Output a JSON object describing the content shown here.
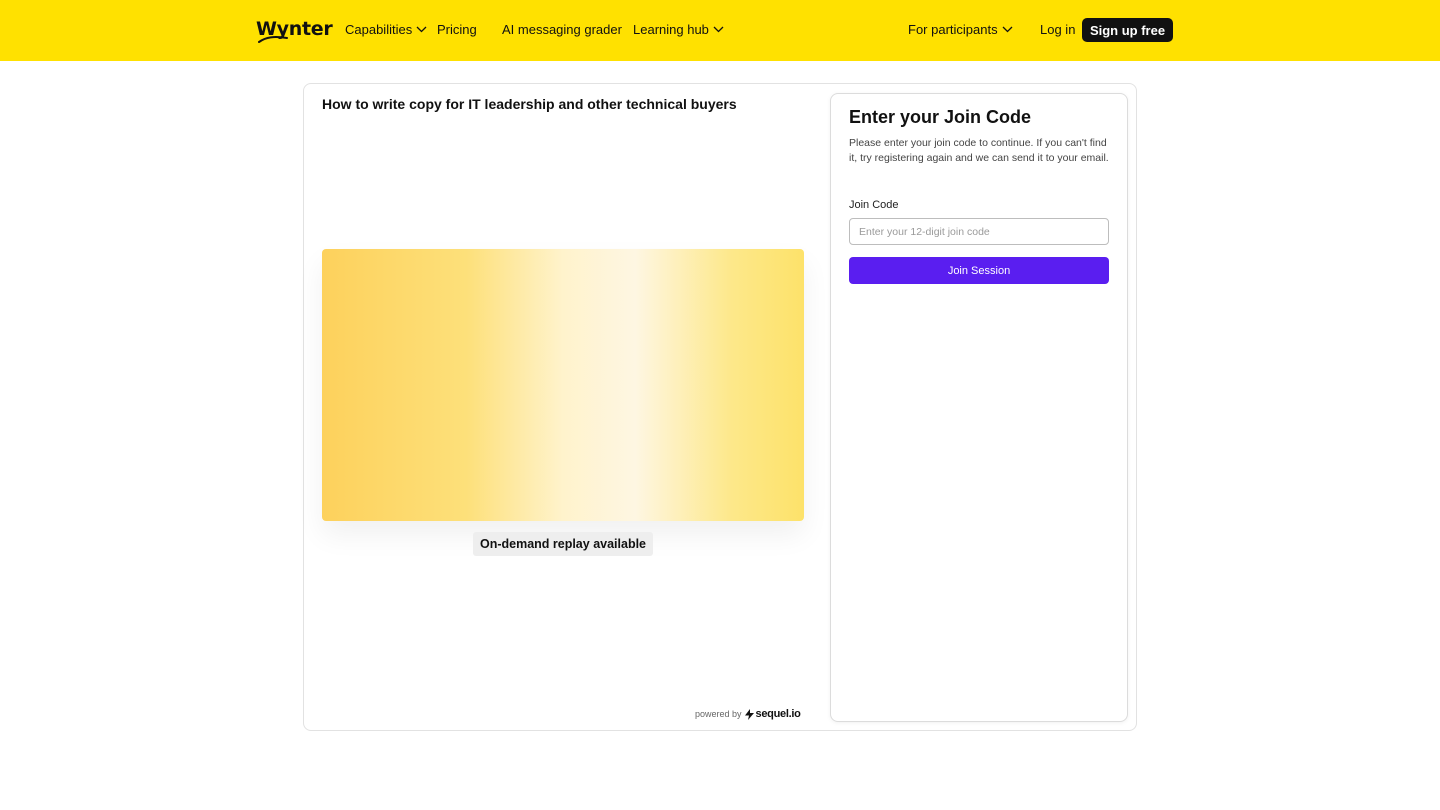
{
  "nav": {
    "logo": "Wynter",
    "items": [
      {
        "label": "Capabilities",
        "has_dropdown": true
      },
      {
        "label": "Pricing",
        "has_dropdown": false
      },
      {
        "label": "AI messaging grader",
        "has_dropdown": false
      },
      {
        "label": "Learning hub",
        "has_dropdown": true
      }
    ],
    "participants": {
      "label": "For participants",
      "has_dropdown": true
    },
    "login": "Log in",
    "signup": "Sign up free"
  },
  "event": {
    "title": "How to write copy for IT leadership and other technical buyers",
    "replay_badge": "On-demand replay available",
    "powered_by": "powered by",
    "powered_brand": "sequel.io"
  },
  "join": {
    "heading": "Enter your Join Code",
    "description": "Please enter your join code to continue. If you can't find it, try registering again and we can send it to your email.",
    "label": "Join Code",
    "input_value": "",
    "input_placeholder": "Enter your 12-digit join code",
    "button": "Join Session"
  },
  "colors": {
    "topbar_bg": "#ffe100",
    "signup_bg": "#111111",
    "join_button_bg": "#5a1ef0"
  },
  "icons": {
    "dropdown": "chevron-down-icon",
    "sequel": "bolt-icon"
  }
}
